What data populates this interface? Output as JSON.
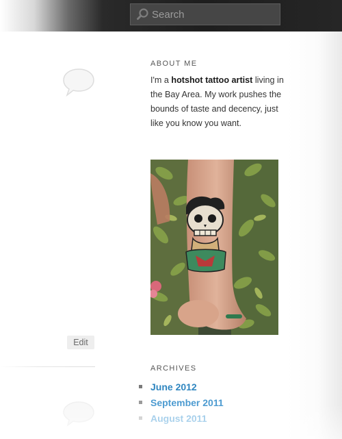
{
  "header": {
    "search": {
      "placeholder": "Search",
      "icon": "search-icon"
    }
  },
  "about": {
    "title": "ABOUT ME",
    "text_before": "I'm a ",
    "text_bold": "hotshot tattoo artist",
    "text_after": " living in the Bay Area. My work pushes the bounds of taste and decency, just like you know you want.",
    "photo_icon": "tattoo-photo"
  },
  "post": {
    "edit_label": "Edit",
    "comment_icon": "comment-bubble-icon"
  },
  "archives": {
    "title": "ARCHIVES",
    "items": [
      {
        "label": "June 2012"
      },
      {
        "label": "September 2011"
      },
      {
        "label": "August 2011"
      }
    ]
  },
  "colors": {
    "link": "#2f86c0",
    "topbar": "#222222",
    "search_field": "#464646"
  }
}
